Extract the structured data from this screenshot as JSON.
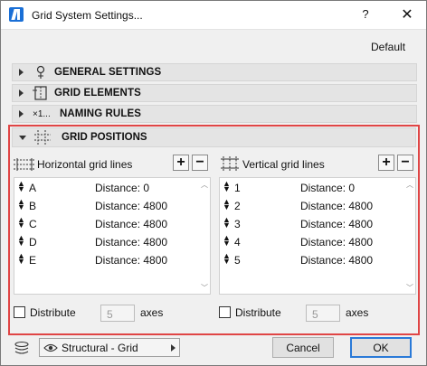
{
  "window": {
    "title": "Grid System Settings...",
    "help": "?",
    "close": "✕"
  },
  "default_label": "Default",
  "sections": [
    {
      "label": "GENERAL SETTINGS",
      "icon": "location-pin-icon"
    },
    {
      "label": "GRID ELEMENTS",
      "icon": "grid-elements-icon"
    },
    {
      "label": "NAMING RULES",
      "icon": "naming-rules-icon",
      "icon_text": "×1..."
    }
  ],
  "grid_positions": {
    "label": "GRID POSITIONS",
    "horizontal": {
      "title": "Horizontal grid lines",
      "plus": "+",
      "minus": "−",
      "rows": [
        {
          "name": "A",
          "distance": "Distance: 0"
        },
        {
          "name": "B",
          "distance": "Distance: 4800"
        },
        {
          "name": "C",
          "distance": "Distance: 4800"
        },
        {
          "name": "D",
          "distance": "Distance: 4800"
        },
        {
          "name": "E",
          "distance": "Distance: 4800"
        }
      ],
      "distribute_label": "Distribute",
      "axes_value": "5",
      "axes_label": "axes"
    },
    "vertical": {
      "title": "Vertical grid lines",
      "plus": "+",
      "minus": "−",
      "rows": [
        {
          "name": "1",
          "distance": "Distance: 0"
        },
        {
          "name": "2",
          "distance": "Distance: 4800"
        },
        {
          "name": "3",
          "distance": "Distance: 4800"
        },
        {
          "name": "4",
          "distance": "Distance: 4800"
        },
        {
          "name": "5",
          "distance": "Distance: 4800"
        }
      ],
      "distribute_label": "Distribute",
      "axes_value": "5",
      "axes_label": "axes"
    }
  },
  "footer": {
    "layer_value": "Structural - Grid",
    "cancel_label": "Cancel",
    "ok_label": "OK"
  },
  "colors": {
    "highlight_border": "#e04545",
    "ok_border": "#2a7ad8"
  }
}
